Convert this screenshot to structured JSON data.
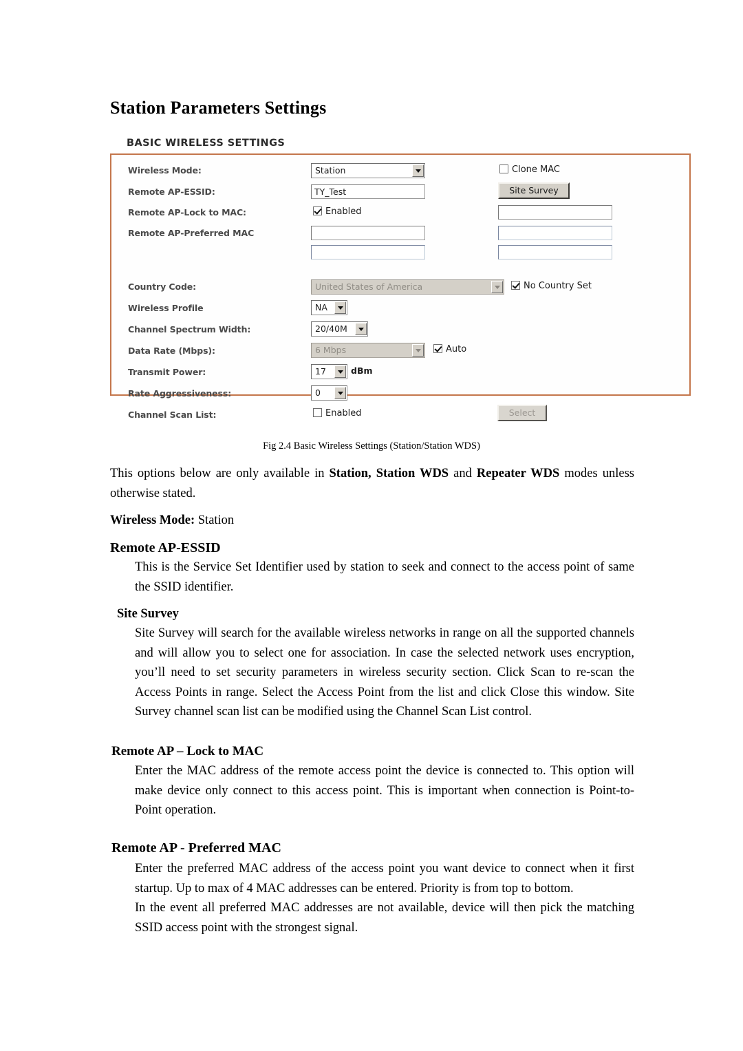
{
  "document": {
    "title": "Station Parameters Settings",
    "caption": "Fig 2.4 Basic Wireless Settings (Station/Station WDS)"
  },
  "panel": {
    "heading": "BASIC WIRELESS SETTINGS",
    "border_color": "#c4764b",
    "rows": {
      "wireless_mode": {
        "label": "Wireless Mode:",
        "value": "Station",
        "clone_mac_label": "Clone MAC",
        "clone_mac_checked": "unchecked"
      },
      "remote_ap_essid": {
        "label": "Remote AP-ESSID:",
        "value": "TY_Test",
        "site_survey_button": "Site Survey"
      },
      "remote_ap_lock_to_mac": {
        "label": "Remote AP-Lock to MAC:",
        "enabled_label": "Enabled",
        "enabled_checked": "checked",
        "mac_field_1": ""
      },
      "remote_ap_preferred_mac": {
        "label": "Remote AP-Preferred MAC",
        "mac_left_1": "",
        "mac_left_2": "",
        "mac_right_1": "",
        "mac_right_2": ""
      },
      "country_code": {
        "label": "Country Code:",
        "value": "United States of America",
        "state": "disabled",
        "no_country_set_label": "No Country Set",
        "no_country_set_checked": "checked"
      },
      "wireless_profile": {
        "label": "Wireless Profile",
        "value": "NA"
      },
      "channel_spectrum_width": {
        "label": "Channel Spectrum Width:",
        "value": "20/40M"
      },
      "data_rate": {
        "label": "Data Rate (Mbps):",
        "value": "6 Mbps",
        "state": "disabled",
        "auto_label": "Auto",
        "auto_checked": "checked"
      },
      "transmit_power": {
        "label": "Transmit Power:",
        "value": "17",
        "unit": "dBm"
      },
      "rate_aggressiveness": {
        "label": "Rate Aggressiveness:",
        "value": "0"
      },
      "channel_scan_list": {
        "label": "Channel Scan List:",
        "enabled_label": "Enabled",
        "enabled_checked": "unchecked",
        "select_button": "Select",
        "select_state": "disabled"
      }
    }
  },
  "body": {
    "intro_p1": "This options below are only available in ",
    "intro_b1": "Station, Station WDS",
    "intro_p2": " and ",
    "intro_b2": "Repeater WDS",
    "intro_p3": " modes unless otherwise stated.",
    "wireless_mode_heading": "Wireless Mode:",
    "wireless_mode_value": " Station",
    "section_essid_heading": "Remote AP-ESSID",
    "section_essid_text": "This is the Service Set Identifier used by station to seek and connect to the access point of same the SSID identifier.",
    "section_sitesurvey_heading": "Site Survey",
    "section_sitesurvey_text": "Site Survey will search for the available wireless networks in range on all the supported channels and will allow you to select one for association. In case the selected network uses encryption, you’ll need to set security parameters in wireless security section. Click Scan to re-scan the Access Points in range. Select the Access Point from the list and click Close this window. Site Survey channel scan list can be modified using the Channel Scan List control.",
    "section_lockmac_heading": "Remote AP – Lock to MAC",
    "section_lockmac_text": "Enter the MAC address of the remote access point the device is connected to. This option will make device only connect to this access point. This is important when connection is Point-to-Point operation.",
    "section_preferredmac_heading": "Remote AP - Preferred MAC",
    "section_preferredmac_text_1": "Enter the preferred MAC address of the access point you want device to connect when it first startup. Up to max of 4 MAC addresses can be entered. Priority is from top to   bottom.",
    "section_preferredmac_text_2": "In the event all preferred MAC addresses are not available, device will then pick the matching SSID access point with the strongest signal."
  }
}
